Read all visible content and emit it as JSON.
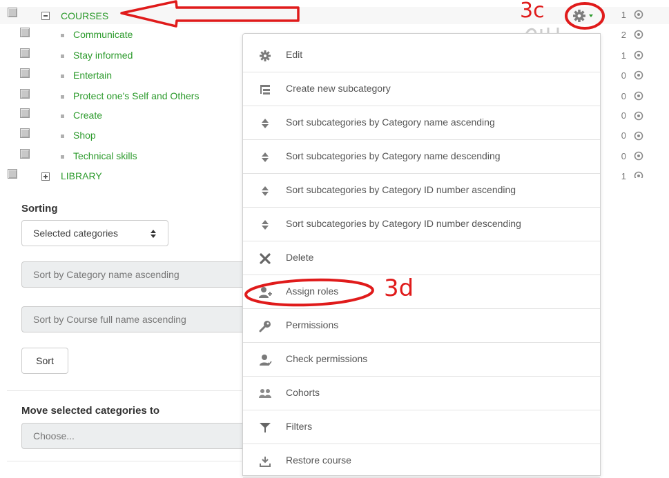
{
  "categories": [
    {
      "name": "COURSES",
      "count": "1"
    },
    {
      "name": "Communicate",
      "count": "2"
    },
    {
      "name": "Stay informed",
      "count": "1"
    },
    {
      "name": "Entertain",
      "count": "0"
    },
    {
      "name": "Protect one's Self and Others",
      "count": "0"
    },
    {
      "name": "Create",
      "count": "0"
    },
    {
      "name": "Shop",
      "count": "0"
    },
    {
      "name": "Technical skills",
      "count": "0"
    },
    {
      "name": "LIBRARY",
      "count": "1"
    }
  ],
  "sorting": {
    "heading": "Sorting",
    "scope_select": "Selected categories",
    "category_sort_select": "Sort by Category name ascending",
    "course_sort_select": "Sort by Course full name ascending",
    "sort_button": "Sort"
  },
  "move": {
    "heading": "Move selected categories to",
    "select_placeholder": "Choose..."
  },
  "menu": {
    "items": [
      {
        "label": "Edit",
        "icon": "gear-icon"
      },
      {
        "label": "Create new subcategory",
        "icon": "subcategory-icon"
      },
      {
        "label": "Sort subcategories by Category name ascending",
        "icon": "sort-icon"
      },
      {
        "label": "Sort subcategories by Category name descending",
        "icon": "sort-icon"
      },
      {
        "label": "Sort subcategories by Category ID number ascending",
        "icon": "sort-icon"
      },
      {
        "label": "Sort subcategories by Category ID number descending",
        "icon": "sort-icon"
      },
      {
        "label": "Delete",
        "icon": "delete-icon"
      },
      {
        "label": "Assign roles",
        "icon": "user-add-icon"
      },
      {
        "label": "Permissions",
        "icon": "key-icon"
      },
      {
        "label": "Check permissions",
        "icon": "user-check-icon"
      },
      {
        "label": "Cohorts",
        "icon": "cohorts-icon"
      },
      {
        "label": "Filters",
        "icon": "filter-icon"
      },
      {
        "label": "Restore course",
        "icon": "restore-icon"
      }
    ]
  },
  "annotations": {
    "label_3c": "3c",
    "label_3d": "3d"
  },
  "colors": {
    "link": "#2b9a2b",
    "annotation": "#e01b1b",
    "menu_border": "#cfcfcf"
  }
}
